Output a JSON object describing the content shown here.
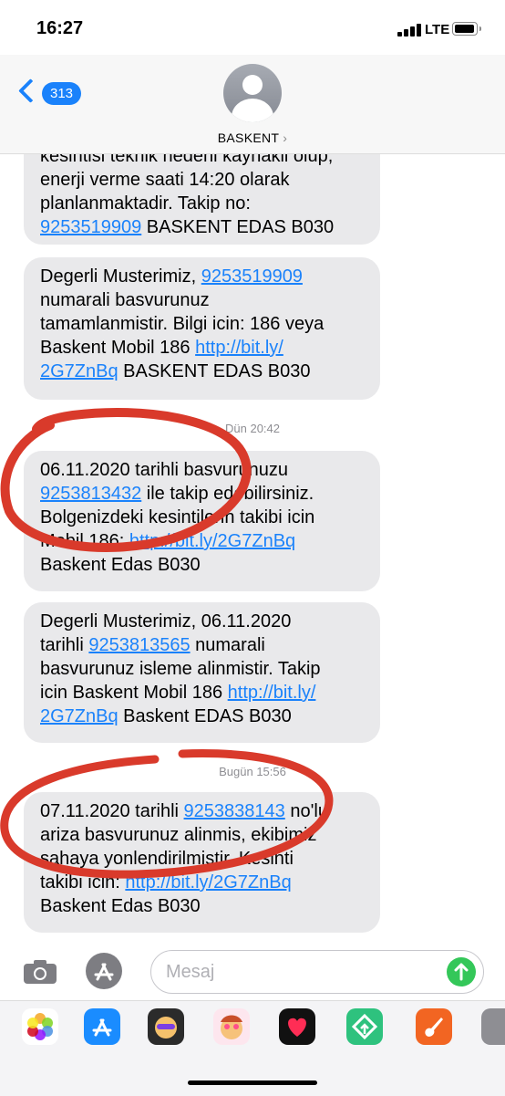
{
  "status": {
    "time": "16:27",
    "network": "LTE"
  },
  "header": {
    "back_count": "313",
    "contact_name": "BASKENT"
  },
  "messages": [
    {
      "clip": "kesintisi teknik nedeni kaynakli olup,",
      "l1": "enerji verme saati 14:20 olarak",
      "l2": "planlanmaktadir. Takip no:",
      "link1": "9253519909",
      "l3": " BASKENT EDAS B030"
    },
    {
      "a": "Degerli Musterimiz, ",
      "link1": "9253519909",
      "l2": "numarali basvurunuz",
      "l3": "tamamlanmistir. Bilgi icin: 186 veya",
      "l4": "Baskent Mobil 186 ",
      "link2a": "http://bit.ly/",
      "link2b": "2G7ZnBq",
      "l5": " BASKENT EDAS B030"
    },
    {
      "l1": "06.11.2020 tarihli basvurunuzu",
      "link1": "9253813432",
      "l2": " ile takip edebilirsiniz.",
      "l3": "Bolgenizdeki kesintilerin takibi icin",
      "l4": "Mobil 186: ",
      "link2": "http://bit.ly/2G7ZnBq",
      "l5": "Baskent Edas B030"
    },
    {
      "l1": "Degerli Musterimiz, 06.11.2020",
      "l2a": "tarihli ",
      "link1": "9253813565",
      "l2b": " numarali",
      "l3": "basvurunuz isleme alinmistir. Takip",
      "l4": "icin Baskent Mobil 186 ",
      "link2a": "http://bit.ly/",
      "link2b": "2G7ZnBq",
      "l5": " Baskent EDAS B030"
    },
    {
      "l1": "07.11.2020 tarihli ",
      "link1": "9253838143",
      "l1b": " no'lu",
      "l2": "ariza basvurunuz alinmis, ekibimiz",
      "l3": "sahaya yonlendirilmistir. Kesinti",
      "l4": "takibi icin: ",
      "link2": "http://bit.ly/2G7ZnBq",
      "l5": "Baskent Edas B030"
    }
  ],
  "timestamps": {
    "t1": "Dün 20:42",
    "t2": "Bugün 15:56"
  },
  "compose": {
    "placeholder": "Mesaj"
  },
  "annotation": {
    "color": "#d93a2b"
  },
  "icons": [
    "camera-icon",
    "app-store-icon",
    "send-icon",
    "photos-icon",
    "memoji-icon",
    "heart-digital-touch-icon",
    "garageband-icon"
  ]
}
